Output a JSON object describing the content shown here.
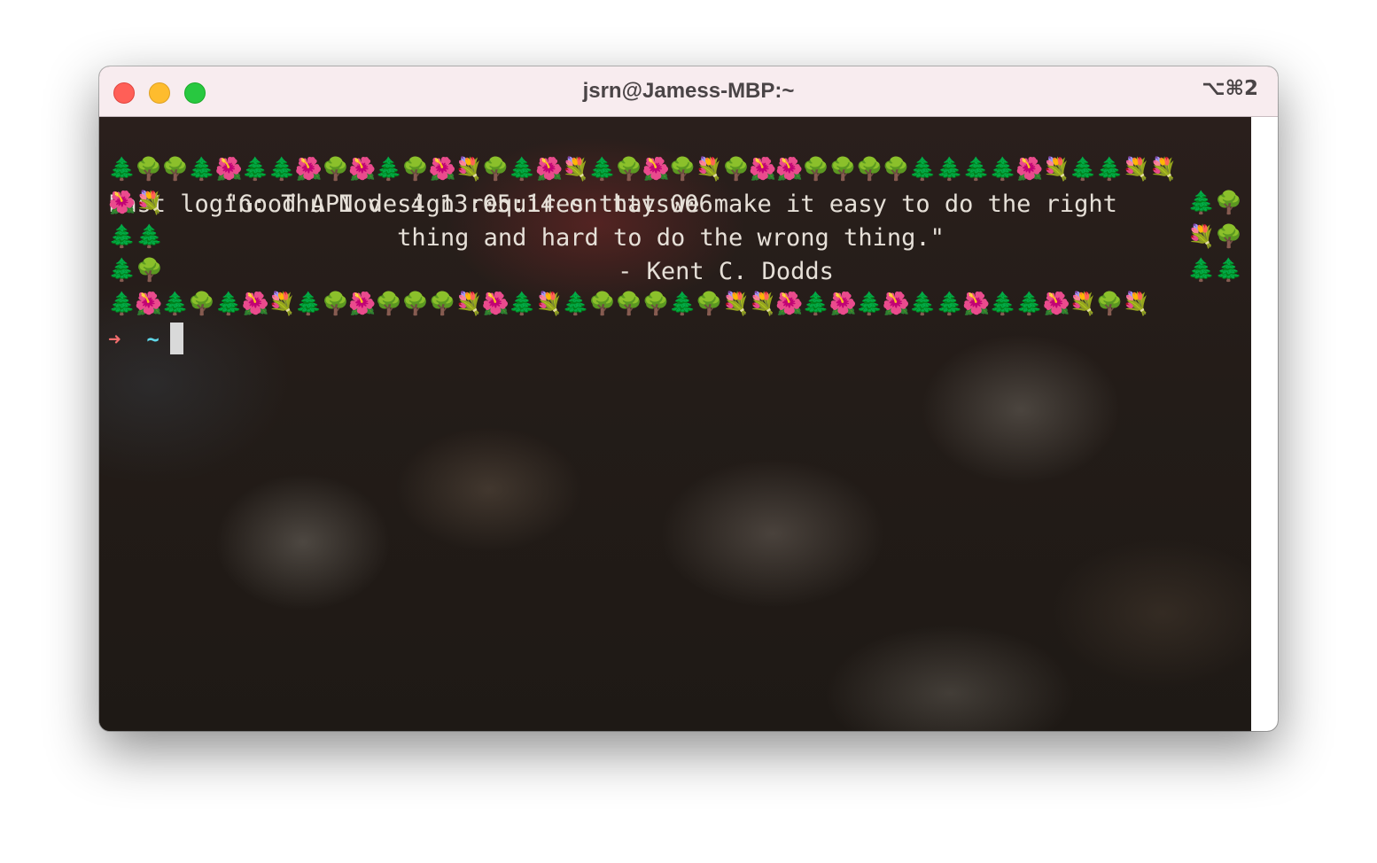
{
  "window": {
    "title": "jsrn@Jamess-MBP:~",
    "shortcut": "⌥⌘2"
  },
  "terminal": {
    "last_login": "Last login: Thu Nov  4 13:05:14 on ttys006",
    "border_top": "🌲🌳🌳🌲🌺🌲🌲🌺🌳🌺🌲🌳🌺💐🌳🌲🌺💐🌲🌳🌺🌳💐🌳🌺🌺🌳🌳🌳🌳🌲🌲🌲🌲🌺💐🌲🌲💐💐",
    "quote_line_1": "\"Good API design requires that we make it easy to do the right",
    "quote_line_2": "thing and hard to do the wrong thing.\"",
    "quote_author": "- Kent C. Dodds",
    "side_left_1": "🌺💐",
    "side_left_2": "🌲🌲",
    "side_left_3": "🌲🌳",
    "side_right_1": "🌲🌳",
    "side_right_2": "💐🌳",
    "side_right_3": "🌲🌲",
    "border_bottom": "🌲🌺🌲🌳🌲🌺💐🌲🌳🌺🌳🌳🌳💐🌺🌲💐🌲🌳🌳🌳🌲🌳💐💐🌺🌲🌺🌲🌺🌲🌲🌺🌲🌲🌺💐🌳💐",
    "prompt_arrow": "➜",
    "prompt_dir": "~"
  },
  "colors": {
    "titlebar": "#f8ecef",
    "close": "#ff5f57",
    "minimize": "#febc2e",
    "zoom": "#28c840",
    "prompt_arrow": "#f26d6d",
    "prompt_dir": "#5fd7e8",
    "text": "#e6e0d8"
  }
}
